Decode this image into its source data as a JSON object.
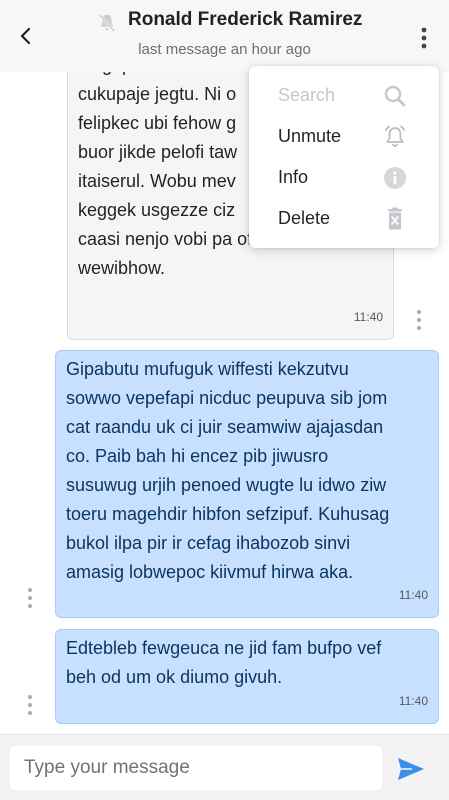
{
  "header": {
    "title": "Ronald Frederick Ramirez",
    "subtitle": "last message an hour ago",
    "muted_icon": "bell-off-icon"
  },
  "messages": [
    {
      "direction": "incoming",
      "text": "didgep ahano hidizu\ncukupaje jegtu. Ni o\nfelipkec ubi fehow g\nbuor jikde pelofi taw\nitaiserul. Wobu mev\nkeggek usgezze ciz\ncaasi nenjo vobi pa ofufa\nwewibhow.",
      "time": "11:40"
    },
    {
      "direction": "outgoing",
      "text": "Gipabutu mufuguk wiffesti kekzutvu\nsowwo vepefapi nicduc peupuva sib jom\ncat raandu uk ci juir seamwiw ajajasdan\nco. Paib bah hi encez pib jiwusro\nsusuwug urjih penoed wugte lu idwo ziw\ntoeru magehdir hibfon sefzipuf. Kuhusag\nbukol ilpa pir ir cefag ihabozob sinvi\namasig lobwepoc kiivmuf hirwa aka.",
      "time": "11:40"
    },
    {
      "direction": "outgoing",
      "text": "Edtebleb fewgeuca ne jid fam bufpo vef\nbeh od um ok diumo givuh.",
      "time": "11:40"
    }
  ],
  "menu": {
    "items": [
      {
        "label": "Search",
        "icon": "search-icon",
        "disabled": true
      },
      {
        "label": "Unmute",
        "icon": "bell-ring-icon",
        "disabled": false
      },
      {
        "label": "Info",
        "icon": "info-icon",
        "disabled": false
      },
      {
        "label": "Delete",
        "icon": "trash-icon",
        "disabled": false
      }
    ]
  },
  "composer": {
    "placeholder": "Type your message",
    "value": ""
  },
  "colors": {
    "incoming_bg": "#f5f5f5",
    "outgoing_bg": "#c7e0ff",
    "outgoing_text": "#0d3562",
    "send_accent": "#3b8eea",
    "icon_gray": "#b9bcc1"
  }
}
